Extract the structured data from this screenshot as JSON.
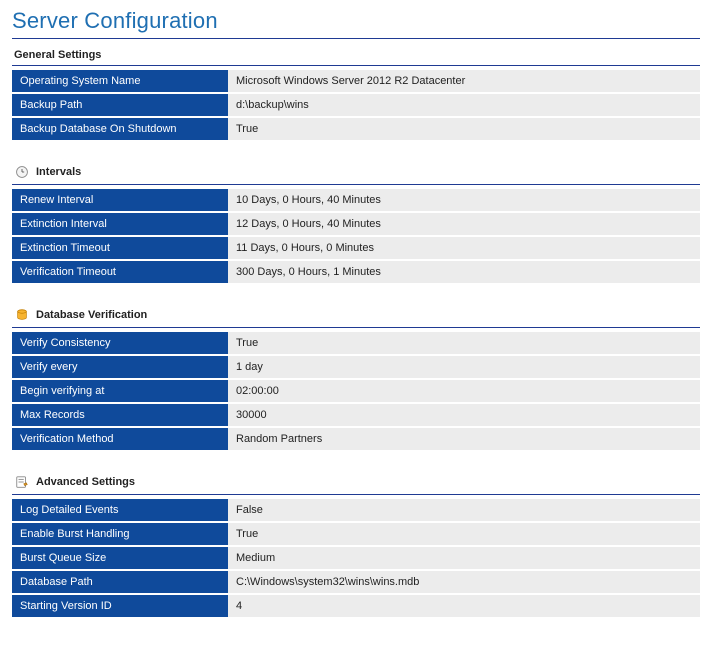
{
  "title": "Server Configuration",
  "sections": [
    {
      "id": "general",
      "title": "General Settings",
      "icon": null,
      "rows": [
        {
          "key": "Operating System Name",
          "val": "Microsoft Windows Server 2012 R2 Datacenter"
        },
        {
          "key": "Backup Path",
          "val": "d:\\backup\\wins"
        },
        {
          "key": "Backup Database On Shutdown",
          "val": "True"
        }
      ]
    },
    {
      "id": "intervals",
      "title": "Intervals",
      "icon": "clock",
      "rows": [
        {
          "key": "Renew Interval",
          "val": "10 Days, 0 Hours, 40 Minutes"
        },
        {
          "key": "Extinction Interval",
          "val": "12 Days, 0 Hours, 40 Minutes"
        },
        {
          "key": "Extinction Timeout",
          "val": "11 Days, 0 Hours, 0 Minutes"
        },
        {
          "key": "Verification Timeout",
          "val": "300 Days, 0 Hours, 1 Minutes"
        }
      ]
    },
    {
      "id": "dbverify",
      "title": "Database Verification",
      "icon": "database",
      "rows": [
        {
          "key": "Verify Consistency",
          "val": "True"
        },
        {
          "key": "Verify every",
          "val": "1 day"
        },
        {
          "key": "Begin verifying at",
          "val": "02:00:00"
        },
        {
          "key": "Max Records",
          "val": "30000"
        },
        {
          "key": "Verification Method",
          "val": "Random Partners"
        }
      ]
    },
    {
      "id": "advanced",
      "title": "Advanced Settings",
      "icon": "settings",
      "rows": [
        {
          "key": "Log Detailed Events",
          "val": "False"
        },
        {
          "key": "Enable Burst Handling",
          "val": "True"
        },
        {
          "key": "Burst Queue Size",
          "val": "Medium"
        },
        {
          "key": "Database Path",
          "val": "C:\\Windows\\system32\\wins\\wins.mdb"
        },
        {
          "key": "Starting Version ID",
          "val": "4"
        }
      ]
    }
  ]
}
